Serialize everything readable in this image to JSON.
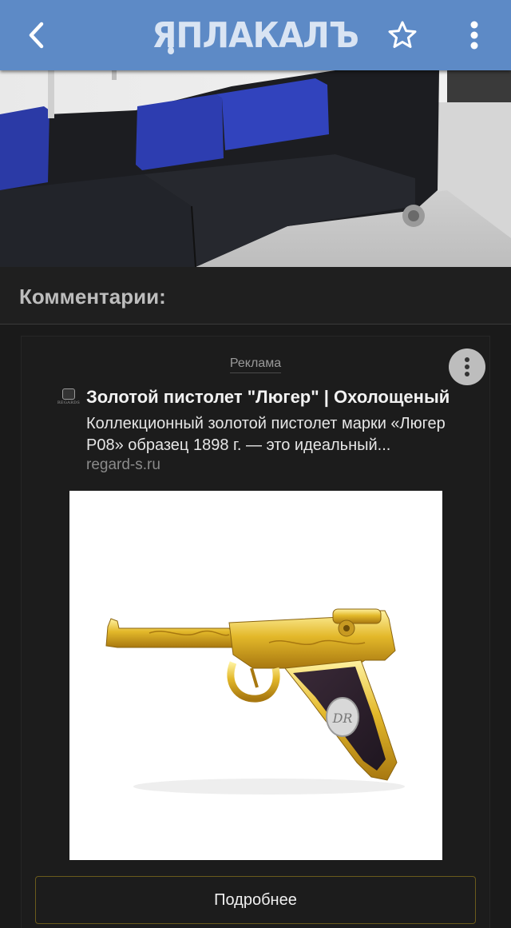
{
  "appbar": {
    "logo_text": "ЯПЛАКАЛЪ",
    "back_icon": "chevron-left-icon",
    "favorite_icon": "star-outline-icon",
    "menu_icon": "more-vertical-icon",
    "background_color": "#5d8ac6"
  },
  "post_image": {
    "description_icon": "photo"
  },
  "comments": {
    "title": "Комментарии:"
  },
  "ad": {
    "label": "Реклама",
    "advertiser_logo_text": "REGARDS",
    "title": "Золотой пистолет \"Люгер\" | Охолощеный",
    "description": "Коллекционный золотой пистолет марки «Люгер P08» образец 1898 г. — это идеальный...",
    "domain": "regard-s.ru",
    "button_label": "Подробнее",
    "menu_icon": "more-vertical-icon"
  }
}
